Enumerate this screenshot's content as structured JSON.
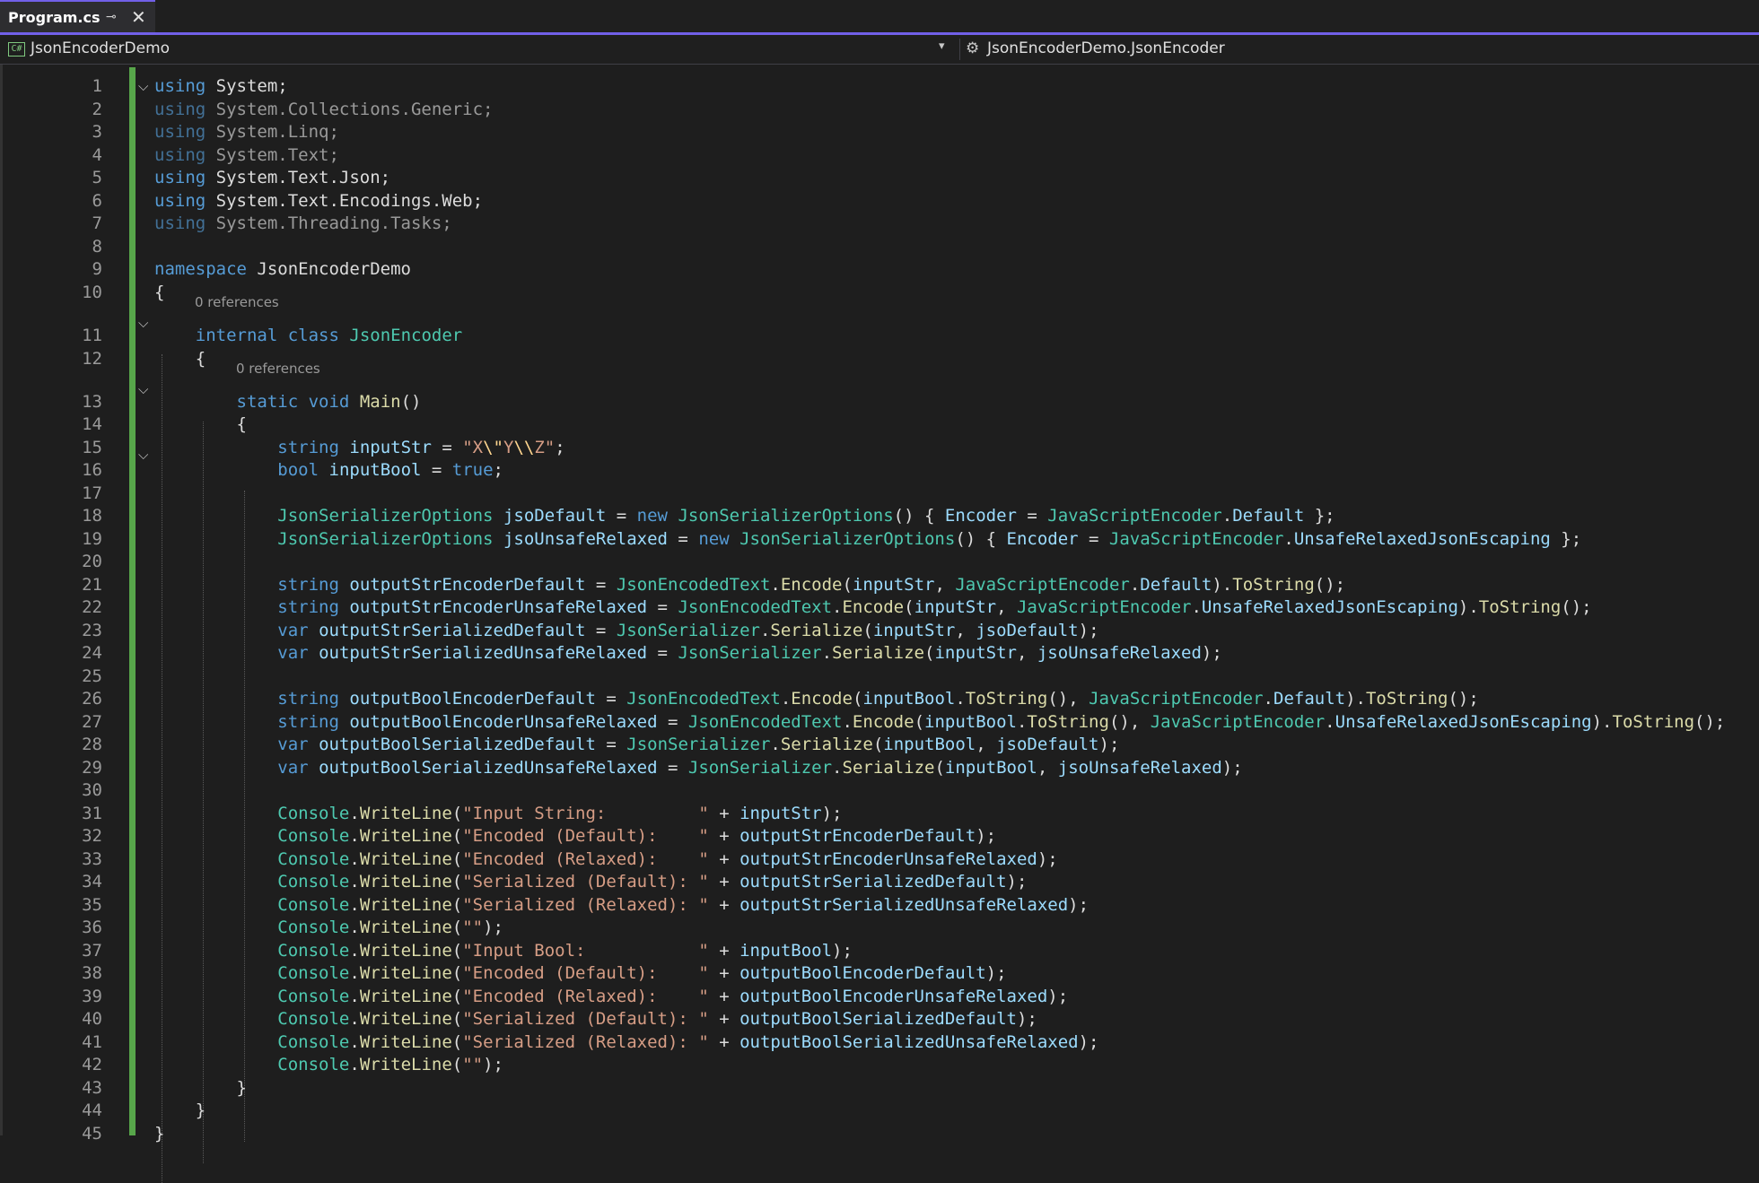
{
  "tab": {
    "title": "Program.cs",
    "pin_glyph": "⊸",
    "close_glyph": "✕"
  },
  "navbar": {
    "project_icon_text": "C#",
    "project": "JsonEncoderDemo",
    "dropdown_glyph": "▾",
    "class_icon_glyph": "⚙",
    "class_path": "JsonEncoderDemo.JsonEncoder"
  },
  "fold_glyph": "⌵",
  "lens_text": "0 references",
  "code": {
    "l1_kw": "using",
    "l1_rest": " System;",
    "l2_kw": "using",
    "l2_rest": " System.Collections.Generic;",
    "l3_kw": "using",
    "l3_rest": " System.Linq;",
    "l4_kw": "using",
    "l4_rest": " System.Text;",
    "l5_kw": "using",
    "l5_rest": " System.Text.Json;",
    "l6_kw": "using",
    "l6_rest": " System.Text.Encodings.Web;",
    "l7_kw": "using",
    "l7_rest": " System.Threading.Tasks;",
    "l9_kw": "namespace",
    "l9_rest": " JsonEncoderDemo",
    "l10": "{",
    "l11_kw": "internal class",
    "l11_ty": "JsonEncoder",
    "l12": "{",
    "l13_kw": "static void",
    "l13_mt": "Main",
    "l13_rest": "()",
    "l14": "{",
    "l15_kw": "string",
    "l15_id": "inputStr",
    "l15_op": " = ",
    "l15_s1": "\"X",
    "l15_e1": "\\\"",
    "l15_s2": "Y",
    "l15_e2": "\\\\",
    "l15_s3": "Z\"",
    "l15_end": ";",
    "l16_kw": "bool",
    "l16_id": "inputBool",
    "l16_op": " = ",
    "l16_kw2": "true",
    "l16_end": ";",
    "l18_ty": "JsonSerializerOptions",
    "l18_id": "jsoDefault",
    "l18_op": " = ",
    "l18_kw": "new",
    "l18_ty2": "JsonSerializerOptions",
    "l18_p1": "() { ",
    "l18_id2": "Encoder",
    "l18_op2": " = ",
    "l18_ty3": "JavaScriptEncoder",
    "l18_p2": ".",
    "l18_id3": "Default",
    "l18_end": " };",
    "l19_ty": "JsonSerializerOptions",
    "l19_id": "jsoUnsafeRelaxed",
    "l19_op": " = ",
    "l19_kw": "new",
    "l19_ty2": "JsonSerializerOptions",
    "l19_p1": "() { ",
    "l19_id2": "Encoder",
    "l19_op2": " = ",
    "l19_ty3": "JavaScriptEncoder",
    "l19_p2": ".",
    "l19_id3": "UnsafeRelaxedJsonEscaping",
    "l19_end": " };",
    "l21_kw": "string",
    "l21_id": "outputStrEncoderDefault",
    "l21_op": " = ",
    "l21_ty": "JsonEncodedText",
    "l21_d": ".",
    "l21_mt": "Encode",
    "l21_p": "(",
    "l21_a1": "inputStr",
    "l21_c": ", ",
    "l21_ty2": "JavaScriptEncoder",
    "l21_d2": ".",
    "l21_a2": "Default",
    "l21_p2": ").",
    "l21_mt2": "ToString",
    "l21_end": "();",
    "l22_kw": "string",
    "l22_id": "outputStrEncoderUnsafeRelaxed",
    "l22_op": " = ",
    "l22_ty": "JsonEncodedText",
    "l22_d": ".",
    "l22_mt": "Encode",
    "l22_p": "(",
    "l22_a1": "inputStr",
    "l22_c": ", ",
    "l22_ty2": "JavaScriptEncoder",
    "l22_d2": ".",
    "l22_a2": "UnsafeRelaxedJsonEscaping",
    "l22_p2": ").",
    "l22_mt2": "ToString",
    "l22_end": "();",
    "l23_kw": "var",
    "l23_id": "outputStrSerializedDefault",
    "l23_op": " = ",
    "l23_ty": "JsonSerializer",
    "l23_d": ".",
    "l23_mt": "Serialize",
    "l23_p": "(",
    "l23_a1": "inputStr",
    "l23_c": ", ",
    "l23_a2": "jsoDefault",
    "l23_end": ");",
    "l24_kw": "var",
    "l24_id": "outputStrSerializedUnsafeRelaxed",
    "l24_op": " = ",
    "l24_ty": "JsonSerializer",
    "l24_d": ".",
    "l24_mt": "Serialize",
    "l24_p": "(",
    "l24_a1": "inputStr",
    "l24_c": ", ",
    "l24_a2": "jsoUnsafeRelaxed",
    "l24_end": ");",
    "l26_kw": "string",
    "l26_id": "outputBoolEncoderDefault",
    "l26_op": " = ",
    "l26_ty": "JsonEncodedText",
    "l26_d": ".",
    "l26_mt": "Encode",
    "l26_p": "(",
    "l26_a1": "inputBool",
    "l26_d3": ".",
    "l26_mt3": "ToString",
    "l26_c": "(), ",
    "l26_ty2": "JavaScriptEncoder",
    "l26_d2": ".",
    "l26_a2": "Default",
    "l26_p2": ").",
    "l26_mt2": "ToString",
    "l26_end": "();",
    "l27_kw": "string",
    "l27_id": "outputBoolEncoderUnsafeRelaxed",
    "l27_op": " = ",
    "l27_ty": "JsonEncodedText",
    "l27_d": ".",
    "l27_mt": "Encode",
    "l27_p": "(",
    "l27_a1": "inputBool",
    "l27_d3": ".",
    "l27_mt3": "ToString",
    "l27_c": "(), ",
    "l27_ty2": "JavaScriptEncoder",
    "l27_d2": ".",
    "l27_a2": "UnsafeRelaxedJsonEscaping",
    "l27_p2": ").",
    "l27_mt2": "ToString",
    "l27_end": "();",
    "l28_kw": "var",
    "l28_id": "outputBoolSerializedDefault",
    "l28_op": " = ",
    "l28_ty": "JsonSerializer",
    "l28_d": ".",
    "l28_mt": "Serialize",
    "l28_p": "(",
    "l28_a1": "inputBool",
    "l28_c": ", ",
    "l28_a2": "jsoDefault",
    "l28_end": ");",
    "l29_kw": "var",
    "l29_id": "outputBoolSerializedUnsafeRelaxed",
    "l29_op": " = ",
    "l29_ty": "JsonSerializer",
    "l29_d": ".",
    "l29_mt": "Serialize",
    "l29_p": "(",
    "l29_a1": "inputBool",
    "l29_c": ", ",
    "l29_a2": "jsoUnsafeRelaxed",
    "l29_end": ");",
    "wl_ty": "Console",
    "wl_d": ".",
    "wl_mt": "WriteLine",
    "wl_p": "(",
    "wl_plus": " + ",
    "wl_end": ");",
    "l31_s": "\"Input String:         \"",
    "l31_id": "inputStr",
    "l32_s": "\"Encoded (Default):    \"",
    "l32_id": "outputStrEncoderDefault",
    "l33_s": "\"Encoded (Relaxed):    \"",
    "l33_id": "outputStrEncoderUnsafeRelaxed",
    "l34_s": "\"Serialized (Default): \"",
    "l34_id": "outputStrSerializedDefault",
    "l35_s": "\"Serialized (Relaxed): \"",
    "l35_id": "outputStrSerializedUnsafeRelaxed",
    "l36_s": "\"\"",
    "l37_s": "\"Input Bool:           \"",
    "l37_id": "inputBool",
    "l38_s": "\"Encoded (Default):    \"",
    "l38_id": "outputBoolEncoderDefault",
    "l39_s": "\"Encoded (Relaxed):    \"",
    "l39_id": "outputBoolEncoderUnsafeRelaxed",
    "l40_s": "\"Serialized (Default): \"",
    "l40_id": "outputBoolSerializedDefault",
    "l41_s": "\"Serialized (Relaxed): \"",
    "l41_id": "outputBoolSerializedUnsafeRelaxed",
    "l42_s": "\"\"",
    "l43": "}",
    "l44": "}",
    "l45": "}"
  }
}
